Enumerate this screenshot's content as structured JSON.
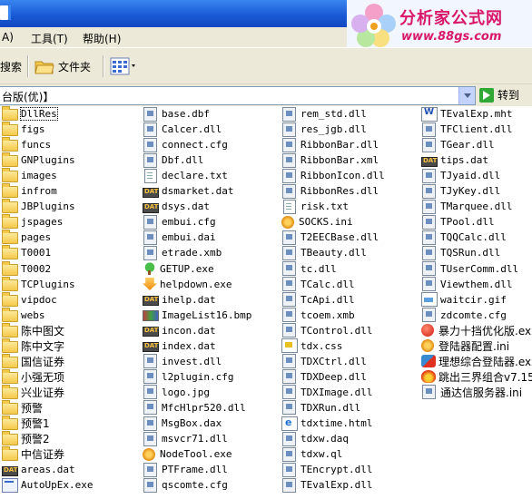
{
  "logo": {
    "title": "分析家公式网",
    "url": "www.88gs.com"
  },
  "menu": {
    "view_partial": "A)",
    "tools": "工具(T)",
    "help": "帮助(H)"
  },
  "toolbar": {
    "search_partial": "搜索",
    "folders": "文件夹"
  },
  "address": {
    "value": "台版(优)】",
    "go": "转到"
  },
  "columns": [
    [
      {
        "name": "DllRes",
        "icon": "folder",
        "selected": true
      },
      {
        "name": "figs",
        "icon": "folder"
      },
      {
        "name": "funcs",
        "icon": "folder"
      },
      {
        "name": "GNPlugins",
        "icon": "folder"
      },
      {
        "name": "images",
        "icon": "folder"
      },
      {
        "name": "infrom",
        "icon": "folder"
      },
      {
        "name": "JBPlugins",
        "icon": "folder"
      },
      {
        "name": "jspages",
        "icon": "folder"
      },
      {
        "name": "pages",
        "icon": "folder"
      },
      {
        "name": "T0001",
        "icon": "folder"
      },
      {
        "name": "T0002",
        "icon": "folder"
      },
      {
        "name": "TCPlugins",
        "icon": "folder"
      },
      {
        "name": "vipdoc",
        "icon": "folder"
      },
      {
        "name": "webs",
        "icon": "folder"
      },
      {
        "name": "陈中图文",
        "icon": "folder"
      },
      {
        "name": "陈中文字",
        "icon": "folder"
      },
      {
        "name": "国信证券",
        "icon": "folder"
      },
      {
        "name": "小强无项",
        "icon": "folder"
      },
      {
        "name": "兴业证券",
        "icon": "folder"
      },
      {
        "name": "预警",
        "icon": "folder"
      },
      {
        "name": "预警1",
        "icon": "folder"
      },
      {
        "name": "预警2",
        "icon": "folder"
      },
      {
        "name": "中信证券",
        "icon": "folder"
      },
      {
        "name": "areas.dat",
        "icon": "dat"
      },
      {
        "name": "AutoUpEx.exe",
        "icon": "exe"
      }
    ],
    [
      {
        "name": "base.dbf",
        "icon": "dll"
      },
      {
        "name": "Calcer.dll",
        "icon": "dll"
      },
      {
        "name": "connect.cfg",
        "icon": "dll"
      },
      {
        "name": "Dbf.dll",
        "icon": "dll"
      },
      {
        "name": "declare.txt",
        "icon": "doc"
      },
      {
        "name": "dsmarket.dat",
        "icon": "dat"
      },
      {
        "name": "dsys.dat",
        "icon": "dat"
      },
      {
        "name": "embui.cfg",
        "icon": "dll"
      },
      {
        "name": "embui.dai",
        "icon": "dll"
      },
      {
        "name": "etrade.xmb",
        "icon": "dll"
      },
      {
        "name": "GETUP.exe",
        "icon": "tree"
      },
      {
        "name": "helpdown.exe",
        "icon": "arrowdown"
      },
      {
        "name": "ihelp.dat",
        "icon": "dat"
      },
      {
        "name": "ImageList16.bmp",
        "icon": "bmp"
      },
      {
        "name": "incon.dat",
        "icon": "dat"
      },
      {
        "name": "index.dat",
        "icon": "dat"
      },
      {
        "name": "invest.dll",
        "icon": "dll"
      },
      {
        "name": "l2plugin.cfg",
        "icon": "dll"
      },
      {
        "name": "logo.jpg",
        "icon": "dll"
      },
      {
        "name": "MfcHlpr520.dll",
        "icon": "dll"
      },
      {
        "name": "MsgBox.dax",
        "icon": "dll"
      },
      {
        "name": "msvcr71.dll",
        "icon": "dll"
      },
      {
        "name": "NodeTool.exe",
        "icon": "gear"
      },
      {
        "name": "PTFrame.dll",
        "icon": "dll"
      },
      {
        "name": "qscomte.cfg",
        "icon": "dll"
      }
    ],
    [
      {
        "name": "rem_std.dll",
        "icon": "dll"
      },
      {
        "name": "res_jgb.dll",
        "icon": "dll"
      },
      {
        "name": "RibbonBar.dll",
        "icon": "dll"
      },
      {
        "name": "RibbonBar.xml",
        "icon": "dll"
      },
      {
        "name": "RibbonIcon.dll",
        "icon": "dll"
      },
      {
        "name": "RibbonRes.dll",
        "icon": "dll"
      },
      {
        "name": "risk.txt",
        "icon": "doc"
      },
      {
        "name": "SOCKS.ini",
        "icon": "gear"
      },
      {
        "name": "T2EECBase.dll",
        "icon": "dll"
      },
      {
        "name": "TBeauty.dll",
        "icon": "dll"
      },
      {
        "name": "tc.dll",
        "icon": "dll"
      },
      {
        "name": "TCalc.dll",
        "icon": "dll"
      },
      {
        "name": "TcApi.dll",
        "icon": "dll"
      },
      {
        "name": "tcoem.xmb",
        "icon": "dll"
      },
      {
        "name": "TControl.dll",
        "icon": "dll"
      },
      {
        "name": "tdx.css",
        "icon": "css"
      },
      {
        "name": "TDXCtrl.dll",
        "icon": "dll"
      },
      {
        "name": "TDXDeep.dll",
        "icon": "dll"
      },
      {
        "name": "TDXImage.dll",
        "icon": "dll"
      },
      {
        "name": "TDXRun.dll",
        "icon": "dll"
      },
      {
        "name": "tdxtime.html",
        "icon": "html"
      },
      {
        "name": "tdxw.daq",
        "icon": "dll"
      },
      {
        "name": "tdxw.ql",
        "icon": "dll"
      },
      {
        "name": "TEncrypt.dll",
        "icon": "dll"
      },
      {
        "name": "TEvalExp.dll",
        "icon": "dll"
      }
    ],
    [
      {
        "name": "TEvalExp.mht",
        "icon": "word"
      },
      {
        "name": "TFClient.dll",
        "icon": "dll"
      },
      {
        "name": "TGear.dll",
        "icon": "dll"
      },
      {
        "name": "tips.dat",
        "icon": "dat"
      },
      {
        "name": "TJyaid.dll",
        "icon": "dll"
      },
      {
        "name": "TJyKey.dll",
        "icon": "dll"
      },
      {
        "name": "TMarquee.dll",
        "icon": "dll"
      },
      {
        "name": "TPool.dll",
        "icon": "dll"
      },
      {
        "name": "TQQCalc.dll",
        "icon": "dll"
      },
      {
        "name": "TQSRun.dll",
        "icon": "dll"
      },
      {
        "name": "TUserComm.dll",
        "icon": "dll"
      },
      {
        "name": "Viewthem.dll",
        "icon": "dll"
      },
      {
        "name": "waitcir.gif",
        "icon": "gif"
      },
      {
        "name": "zdcomte.cfg",
        "icon": "dll"
      },
      {
        "name": "暴力十挡优化版.ex",
        "icon": "redball"
      },
      {
        "name": "登陆器配置.ini",
        "icon": "gear"
      },
      {
        "name": "理想综合登陆器.ex",
        "icon": "tool"
      },
      {
        "name": "跳出三界组合v7.15",
        "icon": "fire"
      },
      {
        "name": "通达信服务器.ini",
        "icon": "dll"
      }
    ]
  ]
}
